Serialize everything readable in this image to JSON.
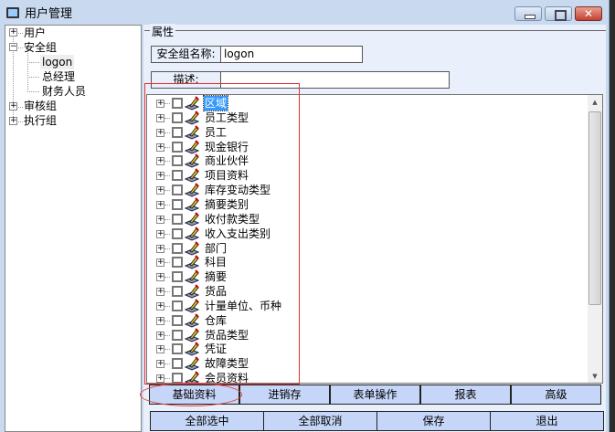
{
  "window": {
    "title": "用户管理",
    "close": "✕"
  },
  "left_tree": [
    {
      "label": "用户",
      "expander": "+"
    },
    {
      "label": "安全组",
      "expander": "−",
      "children": [
        "logon",
        "总经理",
        "财务人员"
      ]
    },
    {
      "label": "审核组",
      "expander": "+"
    },
    {
      "label": "执行组",
      "expander": "+"
    }
  ],
  "props": {
    "group_title": "属性",
    "name_label": "安全组名称:",
    "name_value": "logon",
    "desc_label": "描述:",
    "desc_value": ""
  },
  "permissions": [
    "区域",
    "员工类型",
    "员工",
    "现金银行",
    "商业伙伴",
    "项目资料",
    "库存变动类型",
    "摘要类别",
    "收付款类型",
    "收入支出类别",
    "部门",
    "科目",
    "摘要",
    "货品",
    "计量单位、币种",
    "仓库",
    "货品类型",
    "凭证",
    "故障类型",
    "会员资料"
  ],
  "selected_permission": "区域",
  "tabs": [
    "基础资料",
    "进销存",
    "表单操作",
    "报表",
    "高级"
  ],
  "active_tab": "基础资料",
  "actions": [
    "全部选中",
    "全部取消",
    "保存",
    "退出"
  ]
}
